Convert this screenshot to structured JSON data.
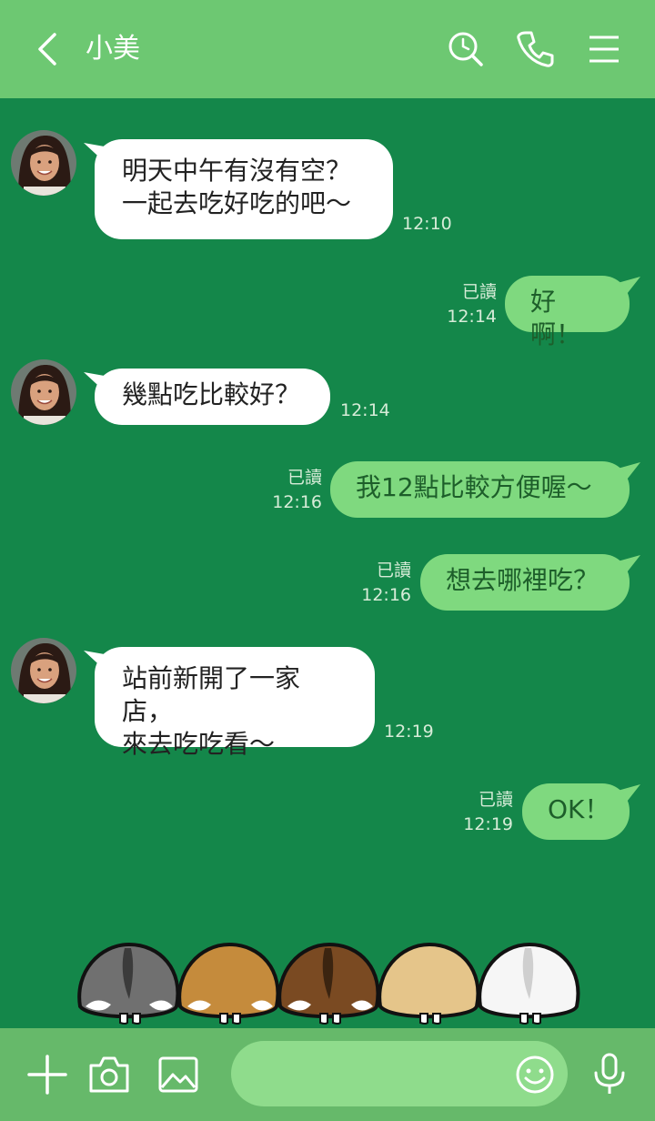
{
  "header": {
    "title": "小美",
    "icons": [
      "back-chevron-icon",
      "search-icon",
      "phone-icon",
      "menu-icon"
    ]
  },
  "messages": [
    {
      "side": "in",
      "text": [
        "明天中午有沒有空？",
        "一起去吃好吃的吧〜"
      ],
      "time": "12:10"
    },
    {
      "side": "out",
      "text": [
        "好啊！"
      ],
      "read": "已讀",
      "time": "12:14"
    },
    {
      "side": "in",
      "text": [
        "幾點吃比較好？"
      ],
      "time": "12:14"
    },
    {
      "side": "out",
      "text": [
        "我12點比較方便喔〜"
      ],
      "read": "已讀",
      "time": "12:16"
    },
    {
      "side": "out",
      "text": [
        "想去哪裡吃？"
      ],
      "read": "已讀",
      "time": "12:16"
    },
    {
      "side": "in",
      "text": [
        "站前新開了一家店，",
        "來去吃吃看〜"
      ],
      "time": "12:19"
    },
    {
      "side": "out",
      "text": [
        "OK！"
      ],
      "read": "已讀",
      "time": "12:19"
    }
  ],
  "stickers": [
    "gray-hamster",
    "tan-hamster",
    "brown-hamster",
    "beige-hamster",
    "white-hamster"
  ],
  "footer": {
    "input_value": "",
    "icons": [
      "plus-icon",
      "camera-icon",
      "image-icon",
      "emoji-icon",
      "microphone-icon"
    ]
  },
  "colors": {
    "header_bg": "#6dc872",
    "chat_bg": "#14874a",
    "incoming_bubble": "#ffffff",
    "outgoing_bubble": "#7fd97f",
    "footer_bg": "#66b96a",
    "input_bg": "#8fdc8c"
  }
}
